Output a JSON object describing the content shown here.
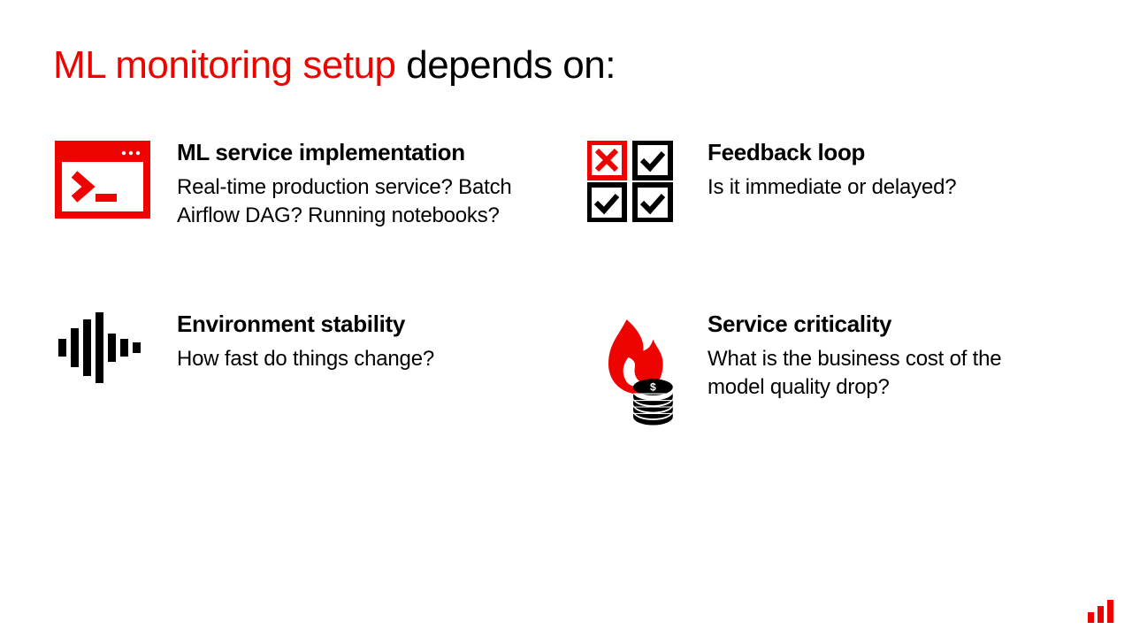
{
  "title_accent": "ML monitoring setup",
  "title_rest": " depends on:",
  "items": [
    {
      "title": "ML service implementation",
      "desc": "Real-time production service? Batch Airflow DAG? Running notebooks?"
    },
    {
      "title": "Feedback loop",
      "desc": "Is it immediate or delayed?"
    },
    {
      "title": "Environment stability",
      "desc": "How fast do things change?"
    },
    {
      "title": "Service criticality",
      "desc": "What is the business cost of the model quality drop?"
    }
  ],
  "colors": {
    "accent": "#ed0400",
    "black": "#000000"
  }
}
